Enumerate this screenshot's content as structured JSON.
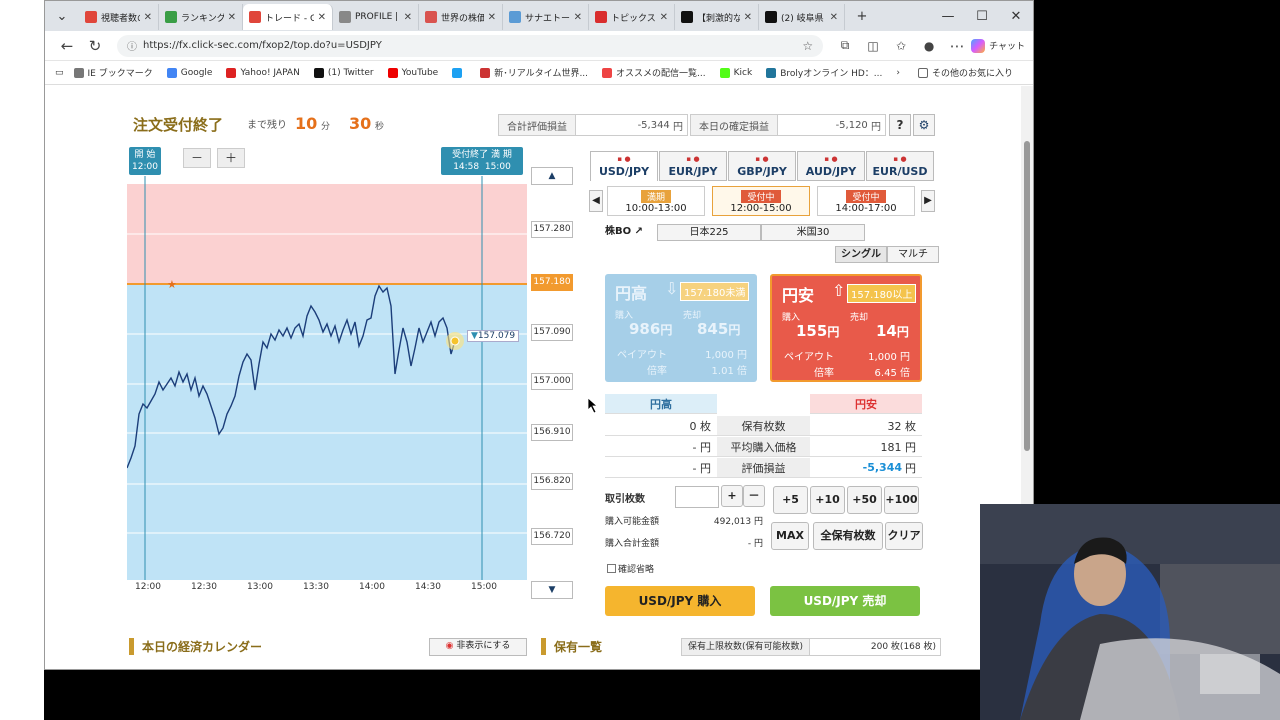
{
  "tabs": [
    {
      "label": "視聴者数の",
      "color": "#e0463b"
    },
    {
      "label": "ランキング",
      "color": "#3a9e46"
    },
    {
      "label": "トレード - GM",
      "color": "#e0463b",
      "active": true
    },
    {
      "label": "PROFILE |",
      "color": "#888888"
    },
    {
      "label": "世界の株価",
      "color": "#d9534f"
    },
    {
      "label": "サナエトーク",
      "color": "#5b9bd5"
    },
    {
      "label": "トピックスー",
      "color": "#d92d2d"
    },
    {
      "label": "【刺激的な",
      "color": "#111111"
    },
    {
      "label": "(2) 岐阜県",
      "color": "#111111"
    }
  ],
  "window": {
    "new_tab": "+",
    "minimize": "—",
    "maximize": "☐",
    "close": "✕",
    "dropdown": "⌄"
  },
  "address": {
    "url": "https://fx.click-sec.com/fxop2/top.do?u=USDJPY",
    "copilot": "チャット"
  },
  "bookmarks": [
    {
      "label": "IE ブックマーク",
      "color": "#777777"
    },
    {
      "label": "Google",
      "color": "#4285f4"
    },
    {
      "label": "Yahoo! JAPAN",
      "color": "#d22"
    },
    {
      "label": "(1) Twitter",
      "color": "#111111"
    },
    {
      "label": "YouTube",
      "color": "#e00"
    },
    {
      "label": "",
      "color": "#1da1f2"
    },
    {
      "label": "新･リアルタイム世界...",
      "color": "#c33"
    },
    {
      "label": "オススメの配信一覧...",
      "color": "#e44"
    },
    {
      "label": "Kick",
      "color": "#53fc18"
    },
    {
      "label": "Brolyオンライン HD：...",
      "color": "#21759b"
    }
  ],
  "bookmarks_other": "その他のお気に入り",
  "header": {
    "title": "注文受付終了",
    "remaining_label": "まで残り",
    "minutes": "10",
    "minutes_unit": "分",
    "seconds": "30",
    "seconds_unit": "秒",
    "total_eval_label": "合計評価損益",
    "total_eval_value": "-5,344",
    "today_label": "本日の確定損益",
    "today_value": "-5,120",
    "yen": "円",
    "help": "?",
    "settings": "⚙"
  },
  "chart": {
    "start_label": "開 始",
    "start_time": "12:00",
    "cutoff_label": "受付終了",
    "cutoff_time": "14:58",
    "expiry_label": "満 期",
    "expiry_time": "15:00",
    "zoom_out": "－",
    "zoom_in": "＋",
    "up": "▲",
    "down": "▼",
    "current_price": "157.079",
    "strike": "157.180",
    "price_labels": [
      "157.280",
      "157.180",
      "157.090",
      "157.000",
      "156.910",
      "156.820",
      "156.720"
    ],
    "x_labels": [
      "12:00",
      "12:30",
      "13:00",
      "13:30",
      "14:00",
      "14:30",
      "15:00"
    ]
  },
  "pairs": [
    {
      "label": "USD/JPY",
      "active": true
    },
    {
      "label": "EUR/JPY"
    },
    {
      "label": "GBP/JPY"
    },
    {
      "label": "AUD/JPY"
    },
    {
      "label": "EUR/USD"
    }
  ],
  "sessions": [
    {
      "status": "満期",
      "time": "10:00-13:00"
    },
    {
      "status": "受付中",
      "time": "12:00-15:00",
      "active": true
    },
    {
      "status": "受付中",
      "time": "14:00-17:00"
    }
  ],
  "sub_markets": {
    "kabu": "株BO ↗",
    "nikkei": "日本225",
    "us": "米国30"
  },
  "mode": {
    "single": "シングル",
    "multi": "マルチ"
  },
  "high": {
    "title": "円高",
    "condition": "157.180未満",
    "buy_label": "購入",
    "sell_label": "売却",
    "buy": "986",
    "sell": "845",
    "yen": "円",
    "payout_label": "ペイアウト",
    "payout": "1,000",
    "odds_label": "倍率",
    "odds": "1.01",
    "odds_unit": "倍"
  },
  "low": {
    "title": "円安",
    "condition": "157.180以上",
    "buy_label": "購入",
    "sell_label": "売却",
    "buy": "155",
    "sell": "14",
    "yen": "円",
    "payout_label": "ペイアウト",
    "payout": "1,000",
    "odds_label": "倍率",
    "odds": "6.45",
    "odds_unit": "倍"
  },
  "positions": {
    "high_head": "円高",
    "low_head": "円安",
    "rows": [
      {
        "label": "保有枚数",
        "high": "0 枚",
        "low": "32 枚"
      },
      {
        "label": "平均購入価格",
        "high": "- 円",
        "low": "181 円"
      },
      {
        "label": "評価損益",
        "high": "- 円",
        "low": "-5,344",
        "low_unit": "円"
      }
    ]
  },
  "order": {
    "qty_label": "取引枚数",
    "plus": "+",
    "minus": "－",
    "quick": [
      "+5",
      "+10",
      "+50",
      "+100"
    ],
    "avail_label": "購入可能金額",
    "avail_value": "492,013 円",
    "total_label": "購入合計金額",
    "total_value": "- 円",
    "max": "MAX",
    "all": "全保有枚数",
    "clear": "クリア",
    "confirm_skip": "確認省略",
    "buy_button": "USD/JPY 購入",
    "sell_button": "USD/JPY 売却"
  },
  "bottom": {
    "calendar": "本日の経済カレンダー",
    "hide": "非表示にする",
    "holdings": "保有一覧",
    "limit_label": "保有上限枚数(保有可能枚数)",
    "limit_value": "200 枚(168 枚)"
  }
}
